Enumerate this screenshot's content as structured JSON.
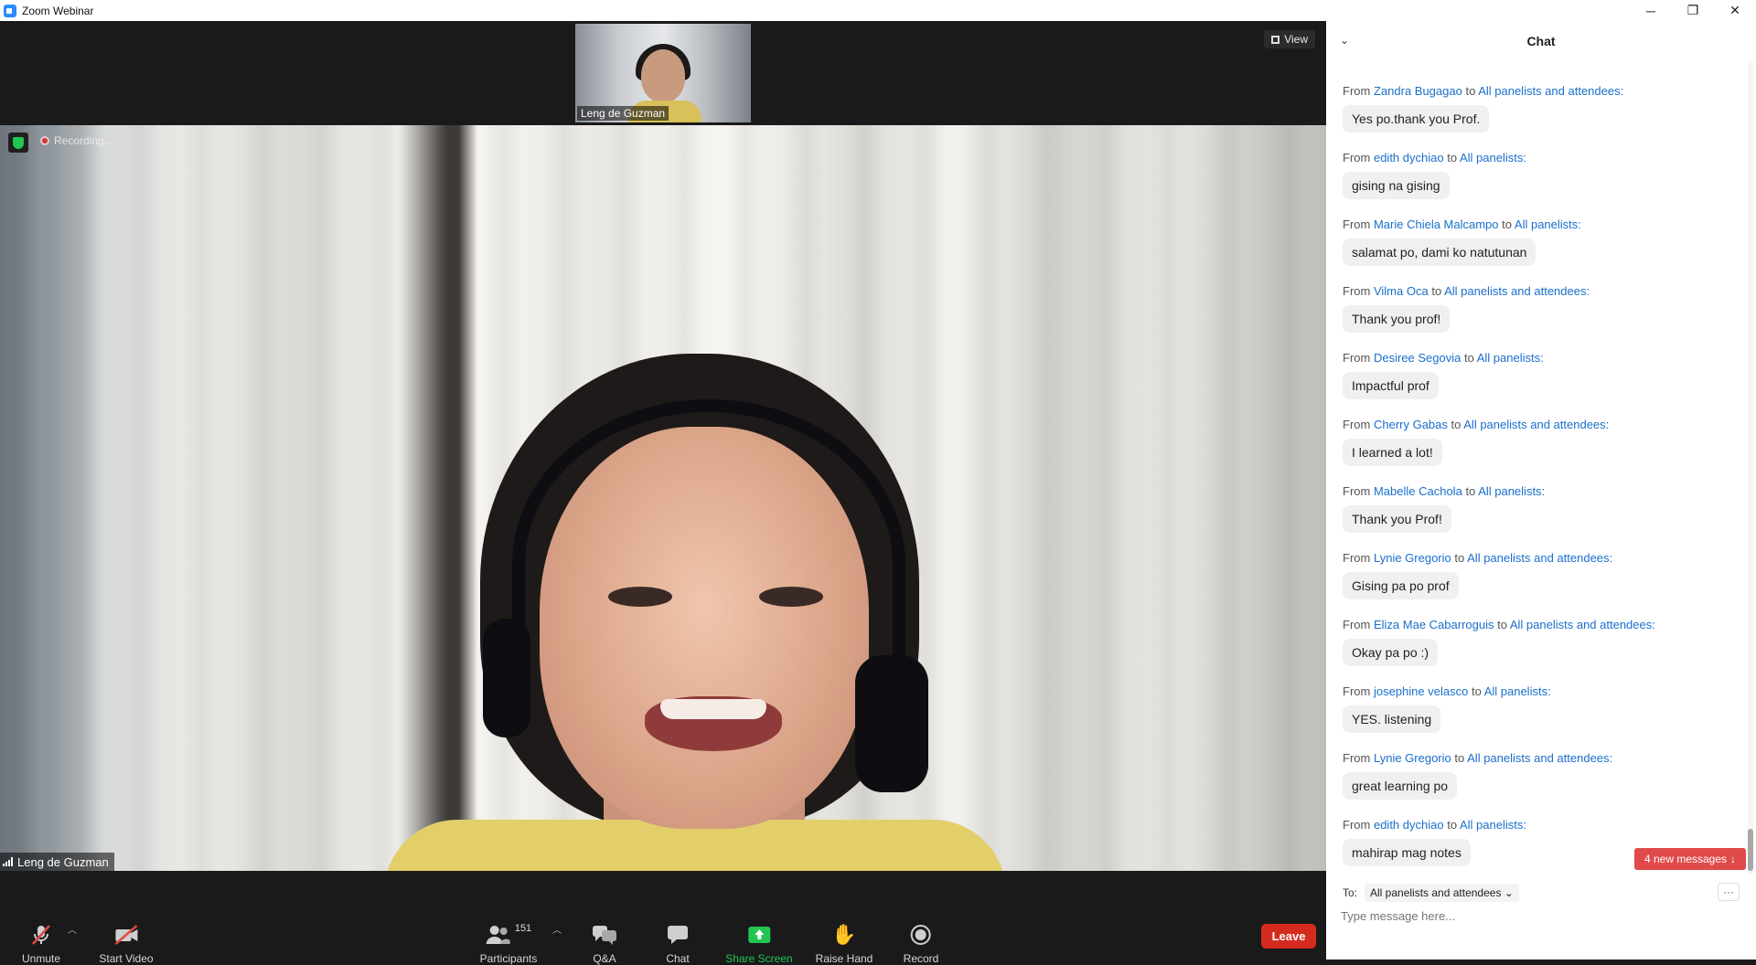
{
  "window": {
    "title": "Zoom Webinar",
    "controls": [
      "─",
      "❐",
      "✕"
    ]
  },
  "video": {
    "thumbnail_name": "Leng de Guzman",
    "view_label": "View",
    "recording_label": "Recording...",
    "speaker_name": "Leng de Guzman"
  },
  "toolbar": {
    "unmute": "Unmute",
    "start_video": "Start Video",
    "participants": "Participants",
    "participant_count": "151",
    "qa": "Q&A",
    "chat": "Chat",
    "share_screen": "Share Screen",
    "raise_hand": "Raise Hand",
    "record": "Record",
    "leave": "Leave",
    "colors": {
      "share_green": "#23c552",
      "leave_red": "#d52b1e"
    }
  },
  "chat": {
    "title": "Chat",
    "from_prefix": "From",
    "to_word": "to",
    "messages": [
      {
        "sender": "Zandra Bugagao",
        "recipient": "All panelists and attendees:",
        "text": "Yes po.thank you Prof."
      },
      {
        "sender": "edith dychiao",
        "recipient": "All panelists:",
        "text": "gising na gising"
      },
      {
        "sender": "Marie Chiela Malcampo",
        "recipient": "All panelists:",
        "text": "salamat po, dami ko natutunan"
      },
      {
        "sender": "Vilma Oca",
        "recipient": "All panelists and attendees:",
        "text": "Thank you prof!"
      },
      {
        "sender": "Desiree Segovia",
        "recipient": "All panelists:",
        "text": "Impactful prof"
      },
      {
        "sender": "Cherry Gabas",
        "recipient": "All panelists and attendees:",
        "text": "I learned a lot!"
      },
      {
        "sender": "Mabelle Cachola",
        "recipient": "All panelists:",
        "text": "Thank you Prof!"
      },
      {
        "sender": "Lynie Gregorio",
        "recipient": "All panelists and attendees:",
        "text": "Gising pa po prof"
      },
      {
        "sender": "Eliza Mae Cabarroguis",
        "recipient": "All panelists and attendees:",
        "text": "Okay pa po :)"
      },
      {
        "sender": "josephine velasco",
        "recipient": "All panelists:",
        "text": "YES. listening"
      },
      {
        "sender": "Lynie Gregorio",
        "recipient": "All panelists and attendees:",
        "text": "great learning po"
      },
      {
        "sender": "edith dychiao",
        "recipient": "All panelists:",
        "text": "mahirap mag notes"
      }
    ],
    "new_messages": "4 new messages",
    "to_label": "To:",
    "to_value": "All panelists and attendees",
    "more": "···",
    "input_placeholder": "Type message here...",
    "link_color": "#1a6fcc"
  }
}
